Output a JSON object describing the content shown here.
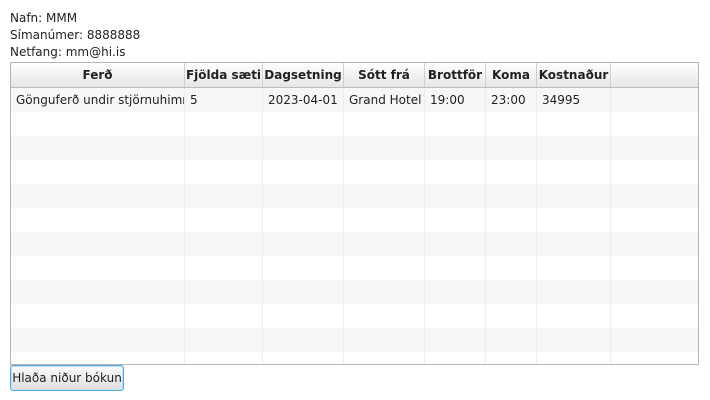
{
  "customer": {
    "name_line": "Nafn: MMM",
    "phone_line": "Símanúmer: 8888888",
    "email_line": "Netfang: mm@hi.is"
  },
  "table": {
    "columns": [
      "Ferð",
      "Fjölda sæti",
      "Dagsetning",
      "Sótt frá",
      "Brottför",
      "Koma",
      "Kostnaður"
    ],
    "rows": [
      [
        "Gönguferð undir stjörnuhimni",
        "5",
        "2023-04-01",
        "Grand Hotel",
        "19:00",
        "23:00",
        "34995"
      ]
    ]
  },
  "actions": {
    "download_label": "Hlaða niður bókun"
  }
}
